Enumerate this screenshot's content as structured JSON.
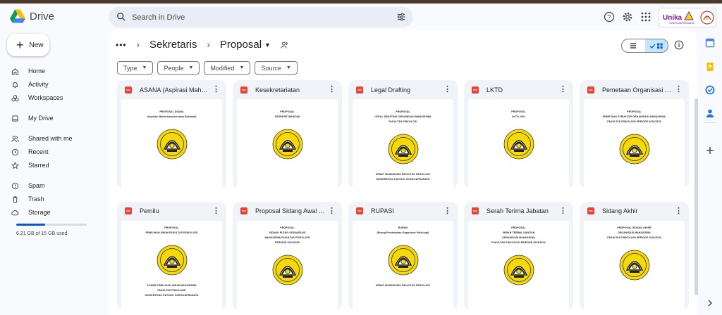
{
  "app": {
    "name": "Drive"
  },
  "search": {
    "placeholder": "Search in Drive"
  },
  "org": {
    "name": "Unika",
    "subtitle": "SOEGIJAPRANATA"
  },
  "sidebar": {
    "new_label": "New",
    "items": [
      {
        "label": "Home",
        "icon": "home-icon"
      },
      {
        "label": "Activity",
        "icon": "activity-icon"
      },
      {
        "label": "Workspaces",
        "icon": "workspaces-icon"
      },
      {
        "label": "My Drive",
        "icon": "my-drive-icon"
      },
      {
        "label": "Shared with me",
        "icon": "shared-icon"
      },
      {
        "label": "Recent",
        "icon": "recent-icon"
      },
      {
        "label": "Starred",
        "icon": "starred-icon"
      },
      {
        "label": "Spam",
        "icon": "spam-icon"
      },
      {
        "label": "Trash",
        "icon": "trash-icon"
      },
      {
        "label": "Storage",
        "icon": "storage-icon"
      }
    ],
    "storage": {
      "text": "6.21 GB of 15 GB used",
      "fraction": 0.414
    }
  },
  "breadcrumb": {
    "dots": "•••",
    "parent": "Sekretaris",
    "current": "Proposal"
  },
  "filters": [
    "Type",
    "People",
    "Modified",
    "Source"
  ],
  "files": [
    {
      "title": "ASANA (Aspirasi Mahasiswa Bersama Bekamal)",
      "thumb": [
        "PROPOSAL ASANA",
        "(Aspirasi Mahasiswa bersama Bekamal)"
      ]
    },
    {
      "title": "Kesekretariatan",
      "thumb": [
        "PROPOSAL",
        "KESEKRETARIATAN"
      ]
    },
    {
      "title": "Legal Drafting",
      "thumb": [
        "PROPOSAL",
        "LEGAL DRAFTING ORGANISASI MAHASISWA",
        "FAKULTAS PSIKOLOGI"
      ],
      "foot": [
        "SENAT MAHASISWA FAKULTAS PSIKOLOGI",
        "UNIVERSITAS KATOLIK SOEGIJAPRANATA"
      ]
    },
    {
      "title": "LKTD",
      "thumb": [
        "PROPOSAL",
        "LKTD 2021"
      ]
    },
    {
      "title": "Pemetaan Organisasi Mahasiswa",
      "thumb": [
        "PROPOSAL",
        "PEMETAAN STRUKTUR ORGANISASI MAHASISWA",
        "FAKULTAS PSIKOLOGI PERIODE 2024/2025"
      ]
    },
    {
      "title": "Pemilu",
      "thumb": [
        "PROPOSAL",
        "PEMILIHAN UMUM FAKULTAS PSIKOLOGI"
      ],
      "foot": [
        "KOMISI PEMILIHAN UMUM MAHASISWA",
        "FAKULTAS PSIKOLOGI",
        "UNIVERSITAS KATOLIK SOEGIJAPRANATA"
      ]
    },
    {
      "title": "Proposal Sidang Awal Tahun",
      "thumb": [
        "PROPOSAL",
        "SIDANG PLENO ORGANISASI",
        "MAHASISWA FAKULTAS PSIKOLOGI",
        "PERIODE 2024/2025"
      ]
    },
    {
      "title": "RUPASI",
      "thumb": [
        "RUPASI",
        "(Ruang Pembekalan Organisasi Psikologi)"
      ],
      "foot": [
        "SENAT MAHASISWA FAKULTAS PSIKOLOGI"
      ]
    },
    {
      "title": "Serah Terima Jabatan",
      "thumb": [
        "PROPOSAL",
        "SERAH TERIMA JABATAN",
        "ORGANISASI MAHASISWA",
        "FAKULTAS PSIKOLOGI PERIODE 2023/2024"
      ]
    },
    {
      "title": "Sidang Akhir",
      "thumb": [
        "PROPOSAL SIDANG AKHIR",
        "ORGANISASI MAHASISWA",
        "FAKULTAS PSIKOLOGI PERIODE 2024/2025"
      ]
    }
  ],
  "file_type_badge": "PDF",
  "colors": {
    "accent": "#0b57d0",
    "selected": "#c2e7ff",
    "pdf": "#ea4335",
    "seal_yellow": "#f5d90a"
  }
}
